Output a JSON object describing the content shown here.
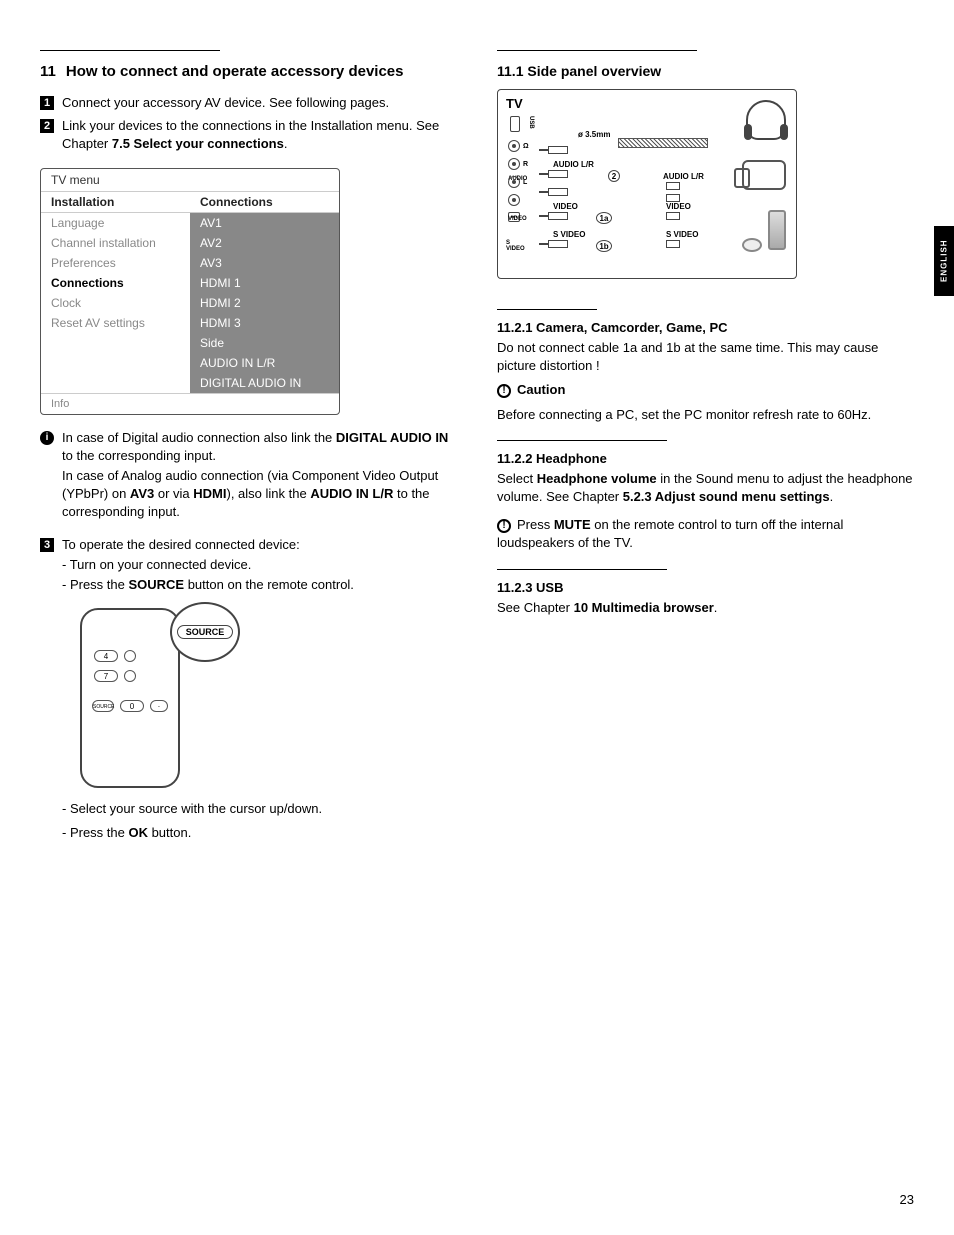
{
  "side_tab": "ENGLISH",
  "page_number": "23",
  "left": {
    "heading_num": "11",
    "heading_text": "How to connect and operate accessory devices",
    "step1_num": "1",
    "step1_text": "Connect your accessory AV device. See following pages.",
    "step2_num": "2",
    "step2_text_a": "Link your devices to the connections in the Installation menu. See Chapter ",
    "step2_text_b": "7.5 Select your connections",
    "step2_text_c": ".",
    "menu": {
      "title": "TV menu",
      "left_head": "Installation",
      "right_head": "Connections",
      "left_items": [
        "Language",
        "Channel installation",
        "Preferences",
        "Connections",
        "Clock",
        "Reset AV settings"
      ],
      "right_items": [
        "AV1",
        "AV2",
        "AV3",
        "HDMI 1",
        "HDMI 2",
        "HDMI 3",
        "Side",
        "AUDIO IN L/R",
        "DIGITAL AUDIO IN"
      ],
      "footer": "Info"
    },
    "info_i": "i",
    "info_p1_a": "In case of Digital audio connection also link the ",
    "info_p1_b": "DIGITAL AUDIO IN",
    "info_p1_c": " to the corresponding input.",
    "info_p2_a": "In case of Analog audio connection (via Component Video Output (YPbPr) on ",
    "info_p2_b": "AV3",
    "info_p2_c": " or via ",
    "info_p2_d": "HDMI",
    "info_p2_e": "), also link the ",
    "info_p2_f": "AUDIO IN L/R",
    "info_p2_g": " to the corresponding input.",
    "step3_num": "3",
    "step3_text": "To operate the desired connected device:",
    "step3_b1": "- Turn on your connected device.",
    "step3_b2_a": "- Press the ",
    "step3_b2_b": "SOURCE",
    "step3_b2_c": " button on the remote control.",
    "remote": {
      "source": "SOURCE",
      "b4": "4",
      "b7": "7",
      "b0": "0",
      "src_small": "SOURCE"
    },
    "step3_b3": "- Select your source with the cursor up/down.",
    "step3_b4_a": "- Press the ",
    "step3_b4_b": "OK",
    "step3_b4_c": " button."
  },
  "right": {
    "h_11_1": "11.1 Side panel overview",
    "panel": {
      "tv": "TV",
      "usb": "USB",
      "hp_sym": "Ω",
      "jack_35": "ø 3.5mm",
      "audio_lr": "AUDIO L/R",
      "audio": "AUDIO",
      "r": "R",
      "l": "L",
      "video": "VIDEO",
      "video2": "VIDEO",
      "svideo": "S VIDEO",
      "svideo2": "S VIDEO",
      "c2": "2",
      "c1a": "1a",
      "c1b": "1b"
    },
    "h_11_2_1": "11.2.1    Camera, Camcorder, Game, PC",
    "p_11_2_1": "Do not connect cable 1a and 1b at the same time. This may cause picture distortion !",
    "caution_icon": "!",
    "caution_label": "Caution",
    "caution_text": "Before connecting a PC, set the PC monitor refresh rate to 60Hz.",
    "h_11_2_2": "11.2.2    Headphone",
    "p_11_2_2_a": "Select ",
    "p_11_2_2_b": "Headphone volume",
    "p_11_2_2_c": " in the Sound menu to adjust the headphone volume. See Chapter ",
    "p_11_2_2_d": "5.2.3  Adjust sound menu settings",
    "p_11_2_2_e": ".",
    "mute_a": "Press ",
    "mute_b": "MUTE",
    "mute_c": " on the remote control to turn off the internal loudspeakers of the TV.",
    "h_11_2_3": "11.2.3    USB",
    "p_11_2_3_a": "See Chapter ",
    "p_11_2_3_b": "10 Multimedia browser",
    "p_11_2_3_c": "."
  }
}
